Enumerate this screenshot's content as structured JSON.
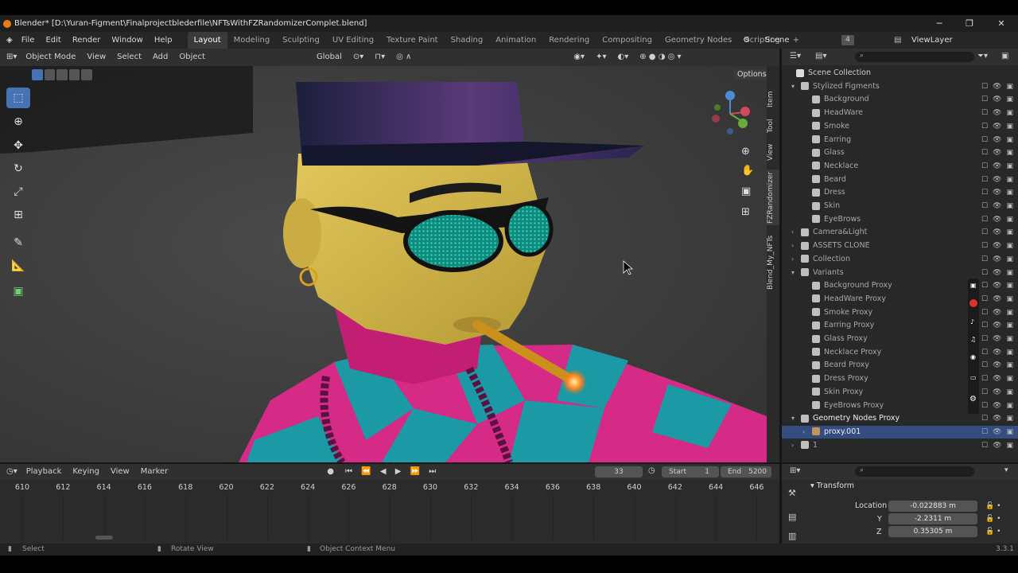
{
  "titlebar": {
    "title": "Blender* [D:\\Yuran-Figment\\Finalprojectblederfile\\NFTsWithFZRandomizerComplet.blend]",
    "minimize": "─",
    "maximize": "❐",
    "close": "✕"
  },
  "menu": [
    "File",
    "Edit",
    "Render",
    "Window",
    "Help"
  ],
  "workspaces": [
    "Layout",
    "Modeling",
    "Sculpting",
    "UV Editing",
    "Texture Paint",
    "Shading",
    "Animation",
    "Rendering",
    "Compositing",
    "Geometry Nodes",
    "Scripting"
  ],
  "active_workspace": "Layout",
  "scene": {
    "label": "Scene",
    "count": "4",
    "viewlayer": "ViewLayer"
  },
  "viewport_header": {
    "mode": "Object Mode",
    "view": "View",
    "select": "Select",
    "add": "Add",
    "object": "Object",
    "transform": "Global",
    "options": "Options"
  },
  "side_tabs": [
    "Item",
    "Tool",
    "View",
    "FZRandomizer",
    "Blend_My_NFTs"
  ],
  "outliner": {
    "root": "Scene Collection",
    "rows": [
      {
        "label": "Stylized Figments",
        "indent": 1,
        "expand": "▾"
      },
      {
        "label": "Background",
        "indent": 2
      },
      {
        "label": "HeadWare",
        "indent": 2
      },
      {
        "label": "Smoke",
        "indent": 2
      },
      {
        "label": "Earring",
        "indent": 2
      },
      {
        "label": "Glass",
        "indent": 2
      },
      {
        "label": "Necklace",
        "indent": 2
      },
      {
        "label": "Beard",
        "indent": 2
      },
      {
        "label": "Dress",
        "indent": 2
      },
      {
        "label": "Skin",
        "indent": 2
      },
      {
        "label": "EyeBrows",
        "indent": 2
      },
      {
        "label": "Camera&Light",
        "indent": 1,
        "expand": "›"
      },
      {
        "label": "ASSETS CLONE",
        "indent": 1,
        "expand": "›"
      },
      {
        "label": "Collection",
        "indent": 1,
        "expand": "›"
      },
      {
        "label": "Variants",
        "indent": 1,
        "expand": "▾"
      },
      {
        "label": "Background Proxy",
        "indent": 2
      },
      {
        "label": "HeadWare Proxy",
        "indent": 2
      },
      {
        "label": "Smoke Proxy",
        "indent": 2
      },
      {
        "label": "Earring Proxy",
        "indent": 2
      },
      {
        "label": "Glass Proxy",
        "indent": 2
      },
      {
        "label": "Necklace Proxy",
        "indent": 2
      },
      {
        "label": "Beard Proxy",
        "indent": 2
      },
      {
        "label": "Dress Proxy",
        "indent": 2
      },
      {
        "label": "Skin Proxy",
        "indent": 2
      },
      {
        "label": "EyeBrows Proxy",
        "indent": 2
      },
      {
        "label": "Geometry Nodes Proxy",
        "indent": 1,
        "expand": "▾",
        "bright": true
      },
      {
        "label": "proxy.001",
        "indent": 2,
        "selected": true,
        "expand": "›"
      },
      {
        "label": "1",
        "indent": 1,
        "expand": "›"
      }
    ]
  },
  "timeline": {
    "playback": "Playback",
    "keying": "Keying",
    "view": "View",
    "marker": "Marker",
    "frame": "33",
    "start_label": "Start",
    "start": "1",
    "end_label": "End",
    "end": "5200",
    "ticks": [
      "610",
      "612",
      "614",
      "616",
      "618",
      "620",
      "622",
      "624",
      "626",
      "628",
      "630",
      "632",
      "634",
      "636",
      "638",
      "640",
      "642",
      "644",
      "646"
    ]
  },
  "properties": {
    "panel": "Transform",
    "location_label": "Location X",
    "y_label": "Y",
    "z_label": "Z",
    "x": "-0.022883 m",
    "y": "-2.2311 m",
    "z": "0.35305 m"
  },
  "status": {
    "select": "Select",
    "rotate": "Rotate View",
    "context": "Object Context Menu",
    "version": "3.3.1"
  },
  "colors": {
    "accent": "#4772b3",
    "header": "#303030",
    "panel": "#282828",
    "viewport": "#3d3d3d"
  }
}
